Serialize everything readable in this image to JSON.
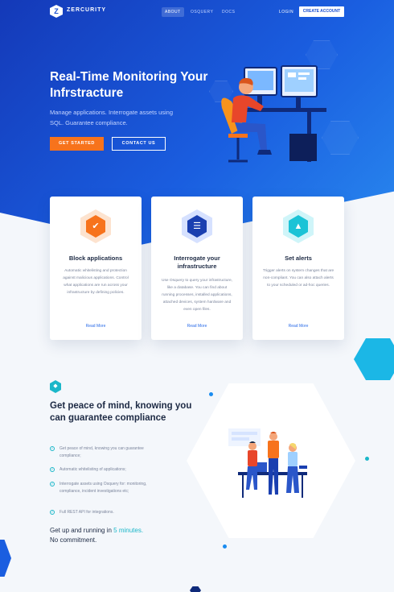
{
  "nav": {
    "brand": "ZERCURITY",
    "links": [
      "ABOUT",
      "OSQUERY",
      "DOCS"
    ],
    "login": "LOGIN",
    "create_account": "CREATE ACCOUNT"
  },
  "hero": {
    "title": "Real-Time Monitoring Your Infrstracture",
    "subtitle": "Manage applications. Interrogate assets using SQL. Guarantee compliance.",
    "primary_button": "GET STARTED",
    "secondary_button": "CONTACT US"
  },
  "features": [
    {
      "title": "Block applications",
      "body": "Automatic whitelisting and protection against malicious applications. Control what applications are run across your infrastructure by defining policies.",
      "link": "Read More",
      "icon": "shield-icon",
      "color": "#f7731c"
    },
    {
      "title": "Interrogate your infrastructure",
      "body": "Use Osquery to query your infrastructure, like a database. You can find about running processes, installed applications, attached devices, system hardware and even open files.",
      "link": "Read More",
      "icon": "server-icon",
      "color": "#1a3fb0"
    },
    {
      "title": "Set alerts",
      "body": "Trigger alerts on system changes that are non-compliant. You can also attach alerts to your scheduled or ad-hoc queries.",
      "link": "Read More",
      "icon": "bell-icon",
      "color": "#1bc3d6"
    }
  ],
  "compliance": {
    "title": "Get peace of mind, knowing you can guarantee compliance",
    "items": [
      "Get peace of mind, knowing you can guarantee compliance;",
      "Automatic whitelisting of applications;",
      "Interrogate assets using Osquery for: monitoring, compliance, incident investigations etc;",
      "Full REST API for integrations."
    ],
    "cta_prefix": "Get up and running in ",
    "cta_accent": "5 minutes.",
    "cta_suffix": "No commitment."
  }
}
